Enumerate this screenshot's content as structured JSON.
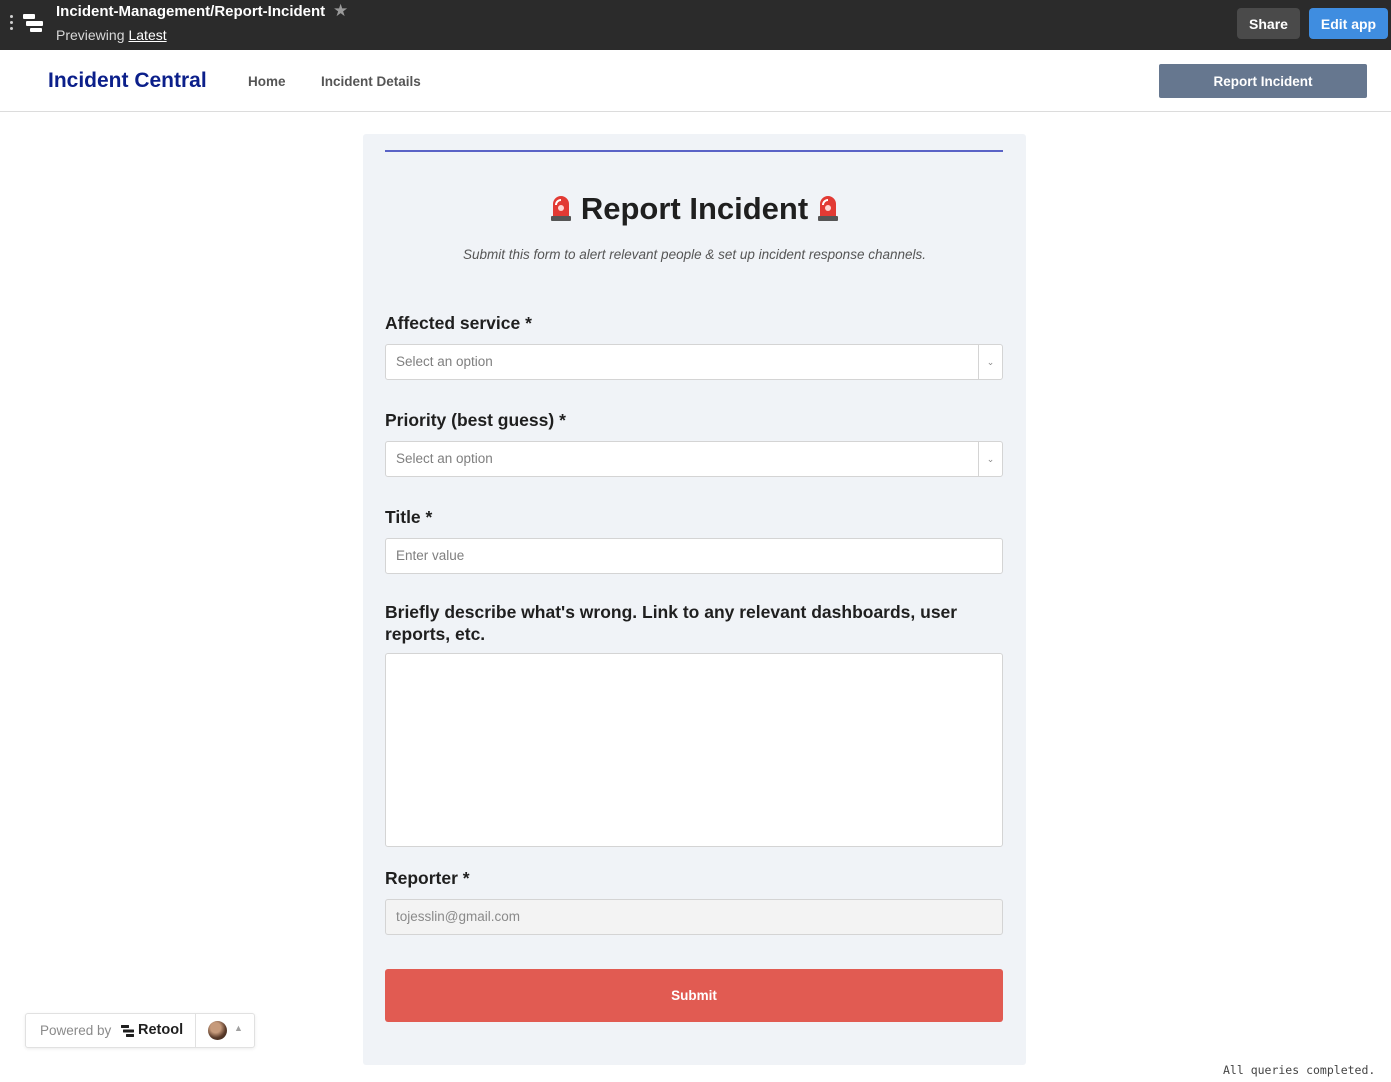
{
  "topbar": {
    "app_path": "Incident-Management/Report-Incident",
    "previewing_label": "Previewing",
    "version_label": "Latest",
    "share_label": "Share",
    "edit_label": "Edit app"
  },
  "nav": {
    "brand": "Incident Central",
    "links": [
      "Home",
      "Incident Details"
    ],
    "report_button": "Report Incident"
  },
  "form": {
    "title": "Report Incident",
    "subtitle": "Submit this form to alert relevant people & set up incident response channels.",
    "affected_service": {
      "label": "Affected service *",
      "placeholder": "Select an option"
    },
    "priority": {
      "label": "Priority (best guess) *",
      "placeholder": "Select an option"
    },
    "title_field": {
      "label": "Title *",
      "placeholder": "Enter value"
    },
    "description": {
      "label": "Briefly describe what's wrong. Link to any relevant dashboards, user reports, etc.",
      "value": ""
    },
    "reporter": {
      "label": "Reporter *",
      "value": "tojesslin@gmail.com"
    },
    "submit_label": "Submit"
  },
  "powered": {
    "prefix": "Powered by",
    "brand": "Retool"
  },
  "status_text": "All queries completed.",
  "colors": {
    "brand": "#0b1f8a",
    "report_button": "#66778f",
    "submit": "#e15b52",
    "edit_button": "#3f8de0",
    "panel": "#f0f3f7"
  }
}
